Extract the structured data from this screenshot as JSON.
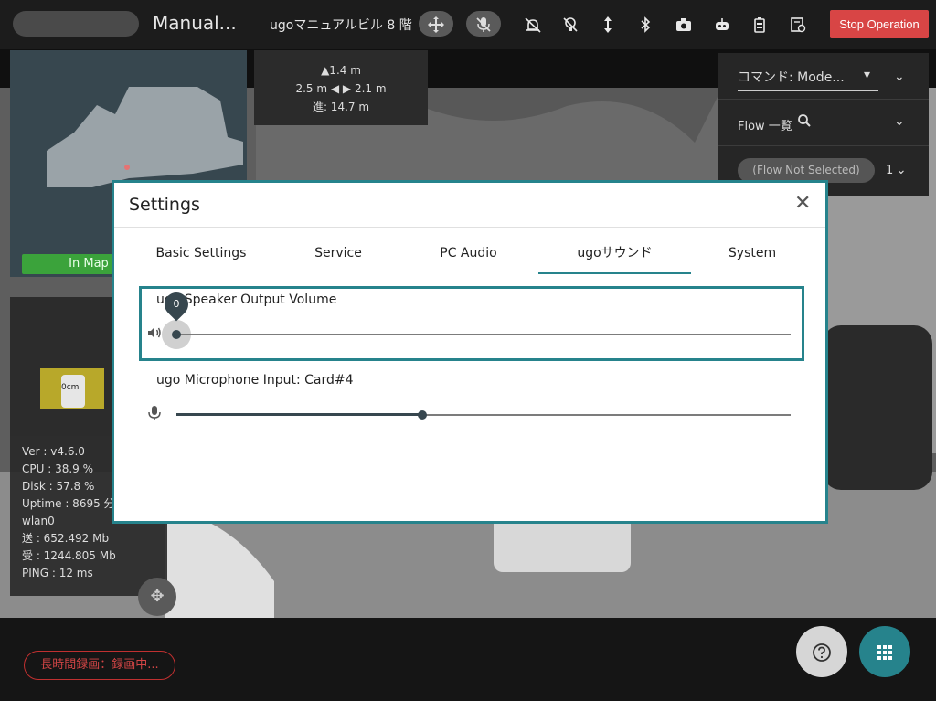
{
  "topbar": {
    "mode_title": "Manual...",
    "robot_name": "ugoマニュアルビル 8 階",
    "stop_label": "Stop Operation",
    "icons": [
      "move-arrows-icon",
      "mic-off-icon",
      "alarm-off-icon",
      "light-off-icon",
      "vertical-arrows-icon",
      "bluetooth-icon",
      "camera-icon",
      "robot-icon",
      "battery-icon",
      "map-settings-icon"
    ]
  },
  "map": {
    "status_label": "In Map"
  },
  "distance": {
    "up": "▲1.4 m",
    "sides": "2.5 m ◀ ▶ 2.1 m",
    "forward": "進: 14.7 m"
  },
  "right_panel": {
    "command_label": "コマンド: Mode...",
    "flow_label": "Flow 一覧",
    "flow_status": "(Flow Not Selected)",
    "flow_count": "1"
  },
  "mini_map": {
    "distance_label": "0cm"
  },
  "stats": {
    "ver": "Ver : v4.6.0",
    "cpu": "CPU : 38.9 %",
    "disk": "Disk : 57.8 %",
    "uptime": "Uptime : 8695 分",
    "iface": "wlan0",
    "sent": "送 : 652.492 Mb",
    "recv": "受 : 1244.805 Mb",
    "ping": "PING : 12 ms"
  },
  "bottom": {
    "recording_label": "長時間録画：録画中..."
  },
  "dialog": {
    "title": "Settings",
    "close": "✕",
    "tabs": [
      "Basic Settings",
      "Service",
      "PC Audio",
      "ugoサウンド",
      "System"
    ],
    "active_tab": "ugoサウンド",
    "speaker": {
      "label": "ugo Speaker Output Volume",
      "value": "0",
      "fraction": 0.0
    },
    "microphone": {
      "label": "ugo Microphone Input: Card#4",
      "fraction": 0.4
    }
  },
  "colors": {
    "accent": "#26838c",
    "stop": "#d84545",
    "in_map": "#3ba33b",
    "slider": "#37474f",
    "recording": "#d24545"
  }
}
